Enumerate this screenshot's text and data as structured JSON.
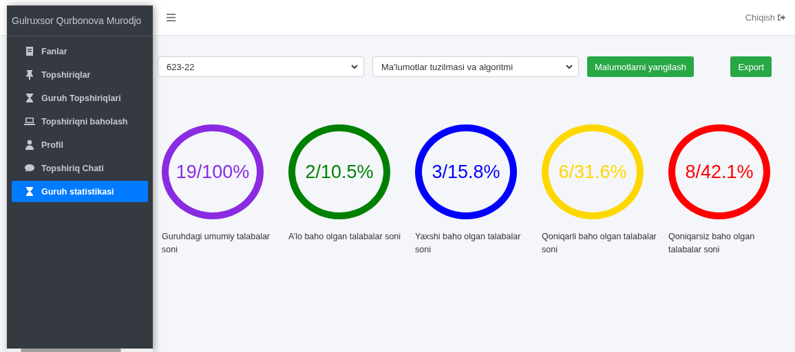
{
  "sidebar": {
    "user_name": "Gulruxsor Qurbonova Murodjo",
    "items": [
      {
        "label": "Fanlar",
        "kind": "book",
        "selected": false
      },
      {
        "label": "Topshiriqlar",
        "kind": "pin",
        "selected": false
      },
      {
        "label": "Guruh Topshiriqlari",
        "kind": "hourglass",
        "selected": false
      },
      {
        "label": "Topshiriqni baholash",
        "kind": "laptop",
        "selected": false
      },
      {
        "label": "Profil",
        "kind": "user",
        "selected": false
      },
      {
        "label": "Topshiriq Chati",
        "kind": "chat",
        "selected": false
      },
      {
        "label": "Guruh statistikasi",
        "kind": "hourglass",
        "selected": true
      }
    ]
  },
  "header": {
    "logout": "Chiqish"
  },
  "filters": {
    "group": "623-22",
    "subject": "Ma'lumotlar tuzilmasi va algoritmi",
    "refresh_button": "Malumotlarni yangilash",
    "export_button": "Export"
  },
  "stats": [
    {
      "value": "19/100%",
      "label": "Guruhdagi umumiy talabalar soni",
      "color": "#8a2be2"
    },
    {
      "value": "2/10.5%",
      "label": "A’lo baho olgan talabalar soni",
      "color": "#008000"
    },
    {
      "value": "3/15.8%",
      "label": "Yaxshi baho olgan talabalar soni",
      "color": "#0000ff"
    },
    {
      "value": "6/31.6%",
      "label": "Qoniqarli baho olgan talabalar soni",
      "color": "#ffd700"
    },
    {
      "value": "8/42.1%",
      "label": "Qoniqarsiz baho olgan talabalar soni",
      "color": "#ff0000"
    }
  ]
}
